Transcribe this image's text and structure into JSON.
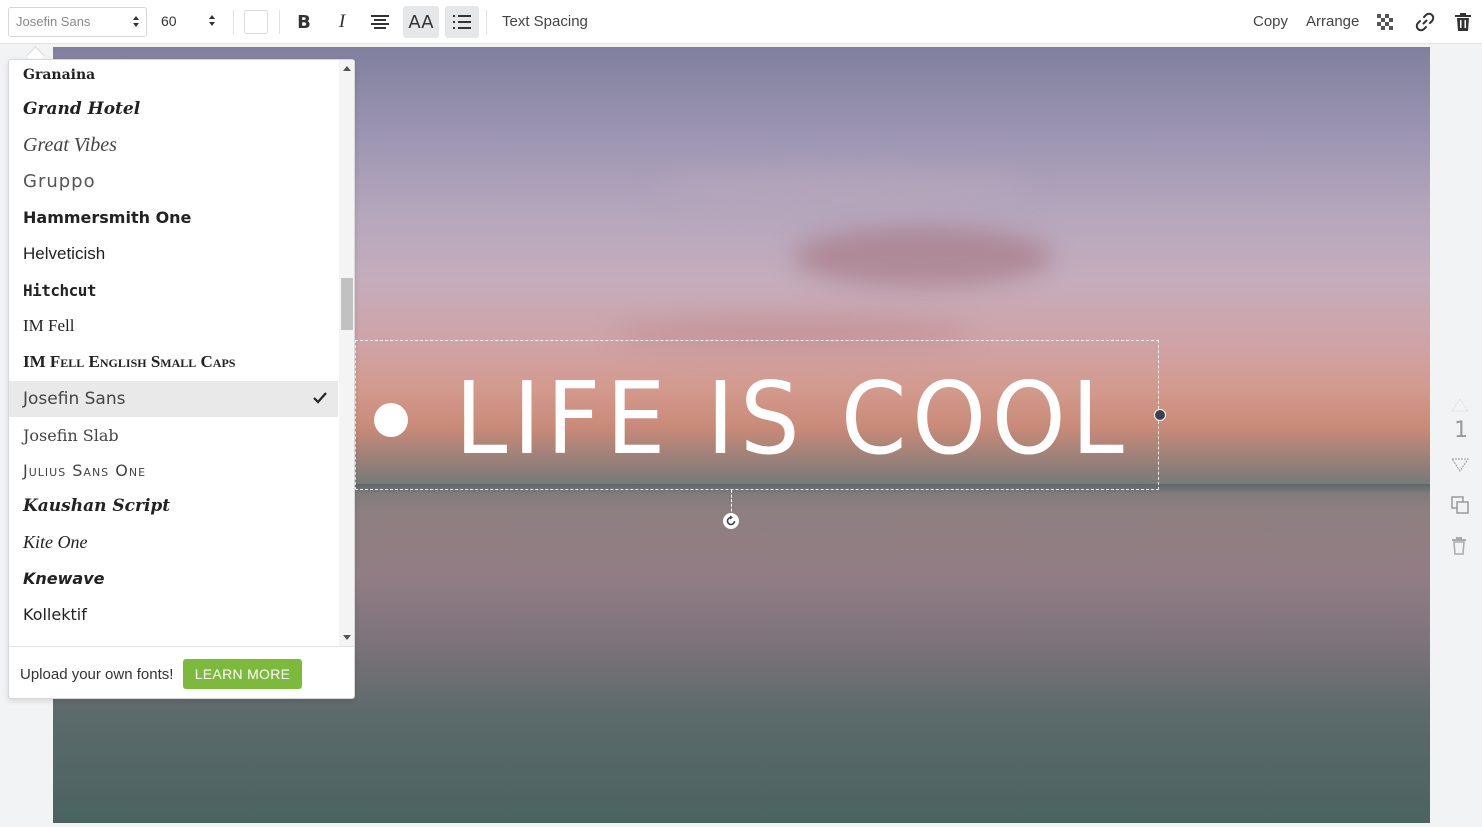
{
  "toolbar": {
    "font_family": "Josefin Sans",
    "font_size": "60",
    "text_color": "#ffffff",
    "bold_icon": "bold-icon",
    "italic_icon": "italic-icon",
    "align_icon": "align-center-icon",
    "uppercase_label": "AA",
    "list_icon": "bulleted-list-icon",
    "text_spacing_label": "Text Spacing",
    "copy_label": "Copy",
    "arrange_label": "Arrange",
    "transparency_icon": "transparency-icon",
    "link_icon": "link-icon",
    "delete_icon": "trash-icon"
  },
  "font_dropdown": {
    "fonts": [
      {
        "name": "Granaina"
      },
      {
        "name": "Grand Hotel"
      },
      {
        "name": "Great Vibes"
      },
      {
        "name": "Gruppo"
      },
      {
        "name": "Hammersmith One"
      },
      {
        "name": "Helveticish"
      },
      {
        "name": "Hitchcut"
      },
      {
        "name": "IM Fell"
      },
      {
        "name": "IM Fell English Small Caps"
      },
      {
        "name": "Josefin Sans"
      },
      {
        "name": "Josefin Slab"
      },
      {
        "name": "Julius Sans One"
      },
      {
        "name": "Kaushan Script"
      },
      {
        "name": "Kite One"
      },
      {
        "name": "Knewave"
      },
      {
        "name": "Kollektif"
      }
    ],
    "selected": "Josefin Sans",
    "footer_text": "Upload your own fonts!",
    "learn_more_label": "LEARN MORE"
  },
  "canvas": {
    "headline": "LIFE IS COOL"
  },
  "right_rail": {
    "page_number": "1"
  },
  "colors": {
    "accent_green": "#7cba3b",
    "selected_row": "#e9e9e9"
  }
}
